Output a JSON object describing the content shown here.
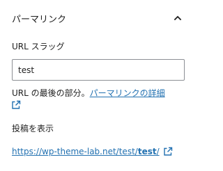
{
  "panel": {
    "title": "パーマリンク",
    "chevron_icon": "chevron-up-icon"
  },
  "slug": {
    "label": "URL スラッグ",
    "value": "test"
  },
  "help": {
    "text": "URL の最後の部分。",
    "link_label": "パーマリンクの詳細",
    "external_icon": "external-link-icon"
  },
  "view_post": {
    "label": "投稿を表示",
    "url_prefix": "https://wp-theme-lab.net/test/",
    "url_slug": "test",
    "url_suffix": "/",
    "external_icon": "external-link-icon"
  },
  "colors": {
    "link": "#2271b1",
    "text": "#1e1e1e",
    "input_border": "#8c8f94"
  }
}
